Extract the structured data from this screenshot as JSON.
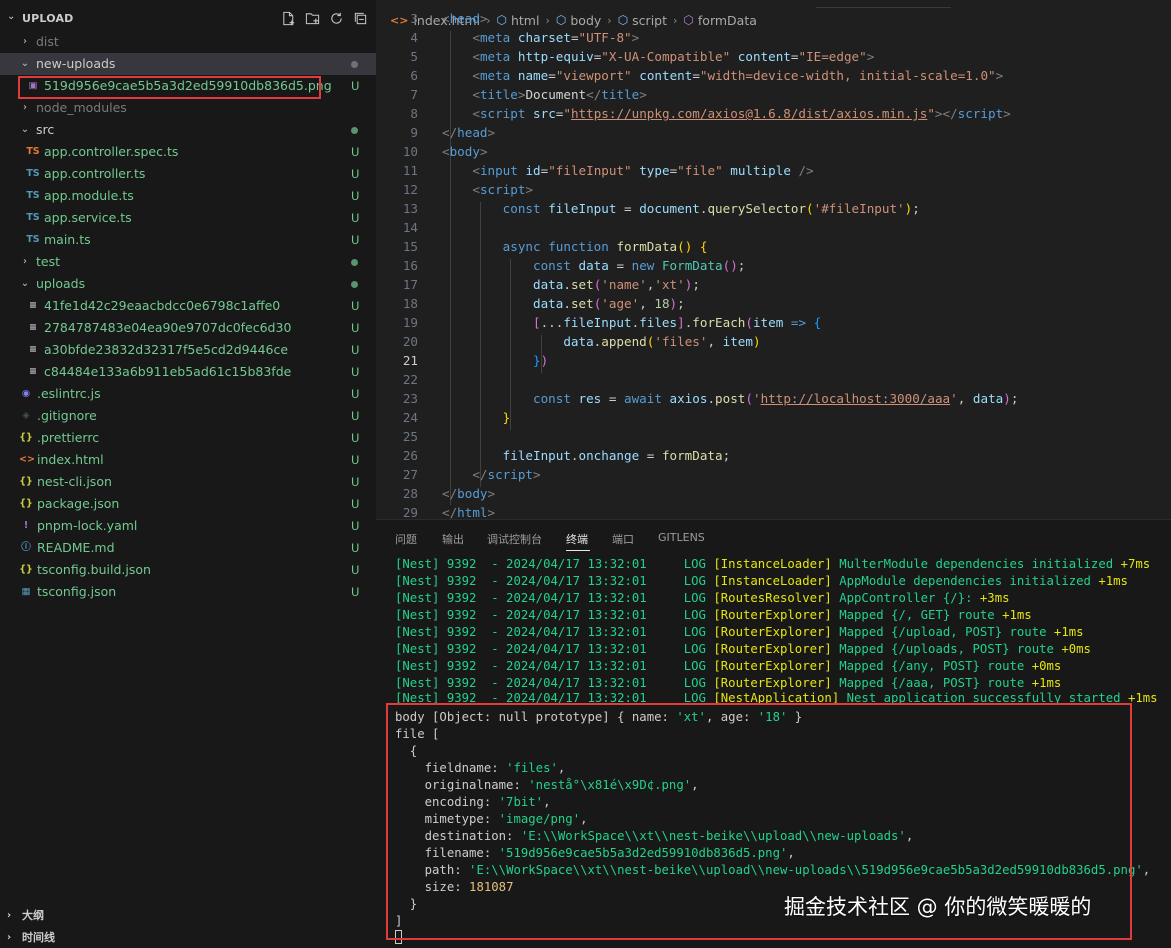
{
  "sidebar": {
    "title": "UPLOAD",
    "tree": [
      {
        "name": "dist",
        "type": "folder",
        "expanded": false,
        "color": "gray",
        "status": ""
      },
      {
        "name": "new-uploads",
        "type": "folder",
        "expanded": true,
        "color": "white",
        "status": "",
        "selected": true,
        "dot": "gray"
      },
      {
        "name": "519d956e9cae5b5a3d2ed59910db836d5.png",
        "type": "file",
        "icon": "image",
        "color": "green",
        "status": "U"
      },
      {
        "name": "node_modules",
        "type": "folder",
        "expanded": false,
        "color": "gray",
        "status": ""
      },
      {
        "name": "src",
        "type": "folder",
        "expanded": true,
        "color": "white",
        "status": "",
        "dot": "green"
      },
      {
        "name": "app.controller.spec.ts",
        "type": "file",
        "icon": "ts-orange",
        "color": "green",
        "status": "U"
      },
      {
        "name": "app.controller.ts",
        "type": "file",
        "icon": "ts",
        "color": "green",
        "status": "U"
      },
      {
        "name": "app.module.ts",
        "type": "file",
        "icon": "ts",
        "color": "green",
        "status": "U"
      },
      {
        "name": "app.service.ts",
        "type": "file",
        "icon": "ts",
        "color": "green",
        "status": "U"
      },
      {
        "name": "main.ts",
        "type": "file",
        "icon": "ts",
        "color": "green",
        "status": "U"
      },
      {
        "name": "test",
        "type": "folder",
        "expanded": false,
        "color": "green",
        "status": "",
        "dot": "green"
      },
      {
        "name": "uploads",
        "type": "folder",
        "expanded": true,
        "color": "green",
        "status": "",
        "dot": "green"
      },
      {
        "name": "41fe1d42c29eaacbdcc0e6798c1affe0",
        "type": "file",
        "icon": "lines",
        "color": "green",
        "status": "U"
      },
      {
        "name": "2784787483e04ea90e9707dc0fec6d30",
        "type": "file",
        "icon": "lines",
        "color": "green",
        "status": "U"
      },
      {
        "name": "a30bfde23832d32317f5e5cd2d9446ce",
        "type": "file",
        "icon": "lines",
        "color": "green",
        "status": "U"
      },
      {
        "name": "c84484e133a6b911eb5ad61c15b83fde",
        "type": "file",
        "icon": "lines",
        "color": "green",
        "status": "U"
      },
      {
        "name": ".eslintrc.js",
        "type": "file",
        "icon": "eslint",
        "color": "green",
        "status": "U"
      },
      {
        "name": ".gitignore",
        "type": "file",
        "icon": "git",
        "color": "green",
        "status": "U"
      },
      {
        "name": ".prettierrc",
        "type": "file",
        "icon": "braces",
        "color": "green",
        "status": "U"
      },
      {
        "name": "index.html",
        "type": "file",
        "icon": "html",
        "color": "green",
        "status": "U"
      },
      {
        "name": "nest-cli.json",
        "type": "file",
        "icon": "braces",
        "color": "green",
        "status": "U"
      },
      {
        "name": "package.json",
        "type": "file",
        "icon": "braces",
        "color": "green",
        "status": "U"
      },
      {
        "name": "pnpm-lock.yaml",
        "type": "file",
        "icon": "yaml",
        "color": "green",
        "status": "U"
      },
      {
        "name": "README.md",
        "type": "file",
        "icon": "info",
        "color": "green",
        "status": "U"
      },
      {
        "name": "tsconfig.build.json",
        "type": "file",
        "icon": "braces",
        "color": "green",
        "status": "U"
      },
      {
        "name": "tsconfig.json",
        "type": "file",
        "icon": "tsconfig",
        "color": "green",
        "status": "U"
      }
    ],
    "outline_label": "大纲",
    "timeline_label": "时间线"
  },
  "breadcrumb": {
    "file": "index.html",
    "items": [
      "html",
      "body",
      "script",
      "formData"
    ]
  },
  "editor": {
    "active_line": "21",
    "lines": [
      {
        "num": "3",
        "html": "<span class=\"t-punc\">&lt;</span><span class=\"t-tag\">head</span><span class=\"t-punc\">&gt;</span>"
      },
      {
        "num": "4",
        "html": "    <span class=\"t-punc\">&lt;</span><span class=\"t-tag\">meta</span> <span class=\"t-attr\">charset</span>=<span class=\"t-str\">\"UTF-8\"</span><span class=\"t-punc\">&gt;</span>"
      },
      {
        "num": "5",
        "html": "    <span class=\"t-punc\">&lt;</span><span class=\"t-tag\">meta</span> <span class=\"t-attr\">http-equiv</span>=<span class=\"t-str\">\"X-UA-Compatible\"</span> <span class=\"t-attr\">content</span>=<span class=\"t-str\">\"IE=edge\"</span><span class=\"t-punc\">&gt;</span>"
      },
      {
        "num": "6",
        "html": "    <span class=\"t-punc\">&lt;</span><span class=\"t-tag\">meta</span> <span class=\"t-attr\">name</span>=<span class=\"t-str\">\"viewport\"</span> <span class=\"t-attr\">content</span>=<span class=\"t-str\">\"width=device-width, initial-scale=1.0\"</span><span class=\"t-punc\">&gt;</span>"
      },
      {
        "num": "7",
        "html": "    <span class=\"t-punc\">&lt;</span><span class=\"t-tag\">title</span><span class=\"t-punc\">&gt;</span><span class=\"t-text\">Document</span><span class=\"t-punc\">&lt;/</span><span class=\"t-tag\">title</span><span class=\"t-punc\">&gt;</span>"
      },
      {
        "num": "8",
        "html": "    <span class=\"t-punc\">&lt;</span><span class=\"t-tag\">script</span> <span class=\"t-attr\">src</span>=<span class=\"t-str\">\"</span><span class=\"t-link\">https://unpkg.com/axios@1.6.8/dist/axios.min.js</span><span class=\"t-str\">\"</span><span class=\"t-punc\">&gt;&lt;/</span><span class=\"t-tag\">script</span><span class=\"t-punc\">&gt;</span>"
      },
      {
        "num": "9",
        "html": "<span class=\"t-punc\">&lt;/</span><span class=\"t-tag\">head</span><span class=\"t-punc\">&gt;</span>"
      },
      {
        "num": "10",
        "html": "<span class=\"t-punc\">&lt;</span><span class=\"t-tag\">body</span><span class=\"t-punc\">&gt;</span>"
      },
      {
        "num": "11",
        "html": "    <span class=\"t-punc\">&lt;</span><span class=\"t-tag\">input</span> <span class=\"t-attr\">id</span>=<span class=\"t-str\">\"fileInput\"</span> <span class=\"t-attr\">type</span>=<span class=\"t-str\">\"file\"</span> <span class=\"t-attr\">multiple</span> <span class=\"t-punc\">/&gt;</span>"
      },
      {
        "num": "12",
        "html": "    <span class=\"t-punc\">&lt;</span><span class=\"t-tag\">script</span><span class=\"t-punc\">&gt;</span>"
      },
      {
        "num": "13",
        "html": "        <span class=\"t-kw\">const</span> <span class=\"t-var\">fileInput</span> = <span class=\"t-var\">document</span>.<span class=\"t-fn\">querySelector</span><span class=\"t-br1\">(</span><span class=\"t-str\">'#fileInput'</span><span class=\"t-br1\">)</span>;"
      },
      {
        "num": "14",
        "html": ""
      },
      {
        "num": "15",
        "html": "        <span class=\"t-kw\">async</span> <span class=\"t-kw\">function</span> <span class=\"t-fn\">formData</span><span class=\"t-br1\">()</span> <span class=\"t-br1\">{</span>"
      },
      {
        "num": "16",
        "html": "            <span class=\"t-kw\">const</span> <span class=\"t-var\">data</span> = <span class=\"t-kw\">new</span> <span class=\"t-cls\">FormData</span><span class=\"t-br2\">()</span>;"
      },
      {
        "num": "17",
        "html": "            <span class=\"t-var\">data</span>.<span class=\"t-fn\">set</span><span class=\"t-br2\">(</span><span class=\"t-str\">'name'</span>,<span class=\"t-str\">'xt'</span><span class=\"t-br2\">)</span>;"
      },
      {
        "num": "18",
        "html": "            <span class=\"t-var\">data</span>.<span class=\"t-fn\">set</span><span class=\"t-br2\">(</span><span class=\"t-str\">'age'</span>, <span class=\"t-num\">18</span><span class=\"t-br2\">)</span>;"
      },
      {
        "num": "19",
        "html": "            <span class=\"t-br2\">[</span>...<span class=\"t-var\">fileInput</span>.<span class=\"t-var\">files</span><span class=\"t-br2\">]</span>.<span class=\"t-fn\">forEach</span><span class=\"t-br2\">(</span><span class=\"t-var\">item</span> <span class=\"t-kw\">=&gt;</span> <span class=\"t-br3\">{</span>"
      },
      {
        "num": "20",
        "html": "                <span class=\"t-var\">data</span>.<span class=\"t-fn\">append</span><span class=\"t-br1\">(</span><span class=\"t-str\">'files'</span>, <span class=\"t-var\">item</span><span class=\"t-br1\">)</span>"
      },
      {
        "num": "21",
        "html": "            <span class=\"t-br3\">}</span><span class=\"t-br2\">)</span>"
      },
      {
        "num": "22",
        "html": ""
      },
      {
        "num": "23",
        "html": "            <span class=\"t-kw\">const</span> <span class=\"t-var\">res</span> = <span class=\"t-kw\">await</span> <span class=\"t-var\">axios</span>.<span class=\"t-fn\">post</span><span class=\"t-br2\">(</span><span class=\"t-str\">'</span><span class=\"t-link\">http://localhost:3000/aaa</span><span class=\"t-str\">'</span>, <span class=\"t-var\">data</span><span class=\"t-br2\">)</span>;"
      },
      {
        "num": "24",
        "html": "        <span class=\"t-br1\">}</span>"
      },
      {
        "num": "25",
        "html": ""
      },
      {
        "num": "26",
        "html": "        <span class=\"t-var\">fileInput</span>.<span class=\"t-var\">onchange</span> = <span class=\"t-fn\">formData</span>;"
      },
      {
        "num": "27",
        "html": "    <span class=\"t-punc\">&lt;/</span><span class=\"t-tag\">script</span><span class=\"t-punc\">&gt;</span>"
      },
      {
        "num": "28",
        "html": "<span class=\"t-punc\">&lt;/</span><span class=\"t-tag\">body</span><span class=\"t-punc\">&gt;</span>"
      },
      {
        "num": "29",
        "html": "<span class=\"t-punc\">&lt;/</span><span class=\"t-tag\">html</span><span class=\"t-punc\">&gt;</span>"
      }
    ]
  },
  "panel": {
    "tabs": [
      {
        "label": "问题",
        "active": false
      },
      {
        "label": "输出",
        "active": false
      },
      {
        "label": "调试控制台",
        "active": false
      },
      {
        "label": "终端",
        "active": true
      },
      {
        "label": "端口",
        "active": false
      },
      {
        "label": "GITLENS",
        "active": false
      }
    ],
    "terminal": [
      "<span class=\"g\">[Nest] 9392  - 2024/04/17 13:32:01     LOG </span><span class=\"y\">[InstanceLoader] </span><span class=\"g\">MulterModule dependencies initialized </span><span class=\"y\">+7ms</span>",
      "<span class=\"g\">[Nest] 9392  - 2024/04/17 13:32:01     LOG </span><span class=\"y\">[InstanceLoader] </span><span class=\"g\">AppModule dependencies initialized </span><span class=\"y\">+1ms</span>",
      "<span class=\"g\">[Nest] 9392  - 2024/04/17 13:32:01     LOG </span><span class=\"y\">[RoutesResolver] </span><span class=\"g\">AppController {/}: </span><span class=\"y\">+3ms</span>",
      "<span class=\"g\">[Nest] 9392  - 2024/04/17 13:32:01     LOG </span><span class=\"y\">[RouterExplorer] </span><span class=\"g\">Mapped {/, GET} route </span><span class=\"y\">+1ms</span>",
      "<span class=\"g\">[Nest] 9392  - 2024/04/17 13:32:01     LOG </span><span class=\"y\">[RouterExplorer] </span><span class=\"g\">Mapped {/upload, POST} route </span><span class=\"y\">+1ms</span>",
      "<span class=\"g\">[Nest] 9392  - 2024/04/17 13:32:01     LOG </span><span class=\"y\">[RouterExplorer] </span><span class=\"g\">Mapped {/uploads, POST} route </span><span class=\"y\">+0ms</span>",
      "<span class=\"g\">[Nest] 9392  - 2024/04/17 13:32:01     LOG </span><span class=\"y\">[RouterExplorer] </span><span class=\"g\">Mapped {/any, POST} route </span><span class=\"y\">+0ms</span>",
      "<span class=\"g\">[Nest] 9392  - 2024/04/17 13:32:01     LOG </span><span class=\"y\">[RouterExplorer] </span><span class=\"g\">Mapped {/aaa, POST} route </span><span class=\"y\">+1ms</span>",
      "<span class=\"g\">[Nest] 9392  - 2024/04/17 13:32:01     LOG </span><span class=\"y\">[NestApplication] </span><span class=\"g\">Nest application successfully started </span><span class=\"y\">+1ms</span>",
      "body [Object: null prototype] { name: <span class=\"s\">'xt'</span>, age: <span class=\"s\">'18'</span> }",
      "file [",
      "  {",
      "    fieldname: <span class=\"s\">'files'</span>,",
      "    originalname: <span class=\"s\">'nestå°\\x81é\\x9D¢.png'</span>,",
      "    encoding: <span class=\"s\">'7bit'</span>,",
      "    mimetype: <span class=\"s\">'image/png'</span>,",
      "    destination: <span class=\"s\">'E:\\\\WorkSpace\\\\xt\\\\nest-beike\\\\upload\\\\new-uploads'</span>,",
      "    filename: <span class=\"s\">'519d956e9cae5b5a3d2ed59910db836d5.png'</span>,",
      "    path: <span class=\"s\">'E:\\\\WorkSpace\\\\xt\\\\nest-beike\\\\upload\\\\new-uploads\\\\519d956e9cae5b5a3d2ed59910db836d5.png'</span>,",
      "    size: <span class=\"n\">181087</span>",
      "  }",
      "]",
      "<span class=\"cursor\"></span>"
    ]
  },
  "watermark": "掘金技术社区 @ 你的微笑暖暖的",
  "colors": {
    "highlight_box": "#e23b3b",
    "untracked_green": "#73c991",
    "log_green": "#23d18b",
    "log_yellow": "#e5e510"
  }
}
